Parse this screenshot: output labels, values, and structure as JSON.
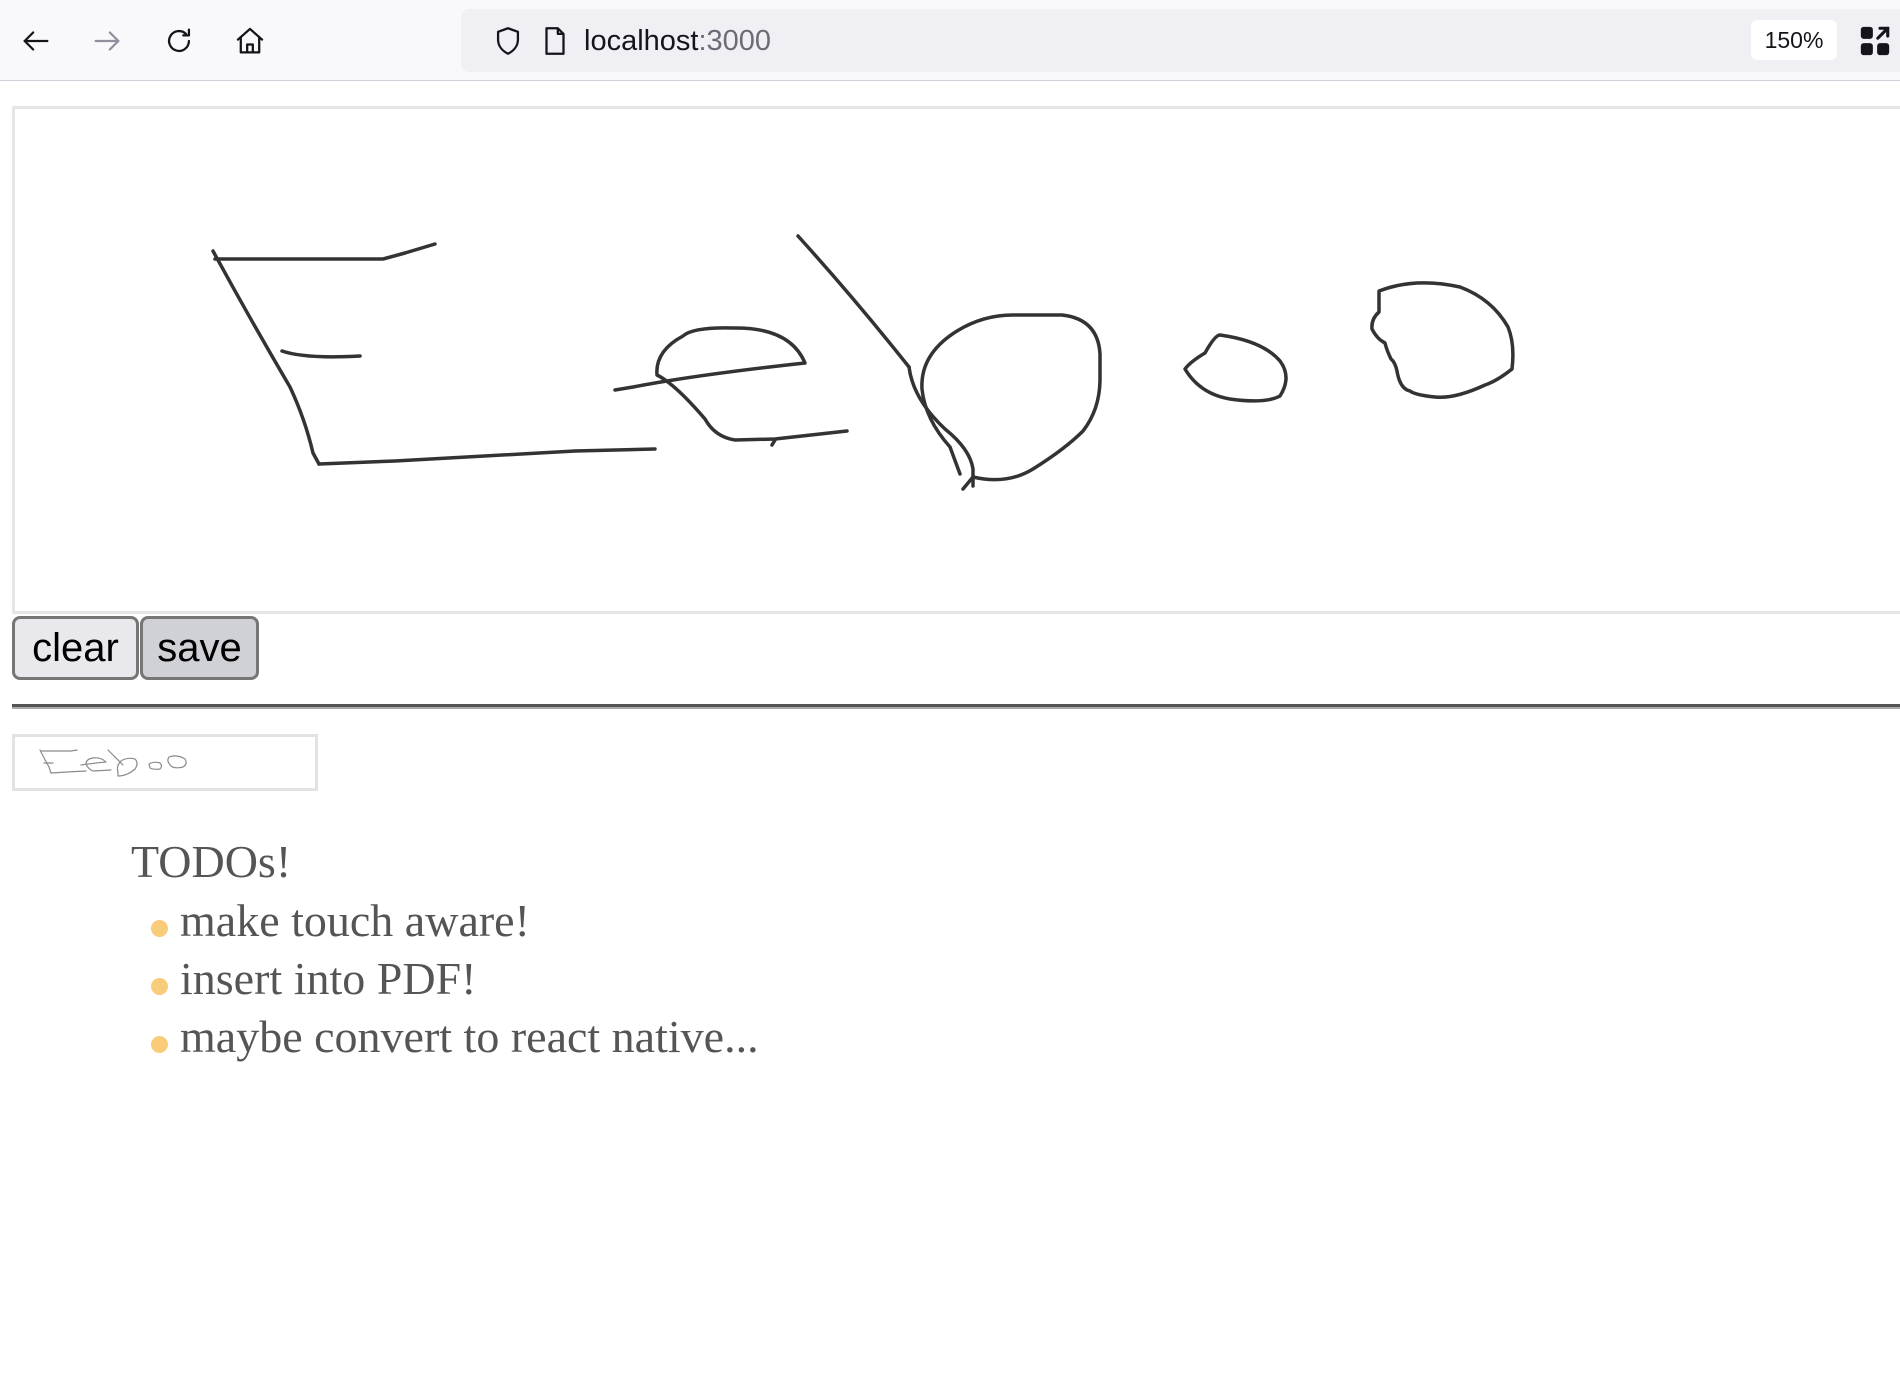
{
  "browser": {
    "url_host": "localhost",
    "url_port": ":3000",
    "zoom": "150%",
    "icons": {
      "back": "arrow-left-icon",
      "forward": "arrow-right-icon",
      "reload": "reload-icon",
      "home": "home-icon",
      "tracking": "shield-icon",
      "page": "page-icon",
      "extensions": "grid-icon"
    }
  },
  "signature_pad": {
    "drawing": "Eeboo"
  },
  "controls": {
    "clear_label": "clear",
    "save_label": "save"
  },
  "saved_preview": {
    "text": "Eeboo"
  },
  "todos": {
    "title": "TODOs!",
    "items": [
      "make touch aware!",
      "insert into PDF!",
      "maybe convert to react native..."
    ]
  },
  "colors": {
    "bullet": "#f8cc78",
    "stroke": "#333333",
    "text": "#555555"
  }
}
